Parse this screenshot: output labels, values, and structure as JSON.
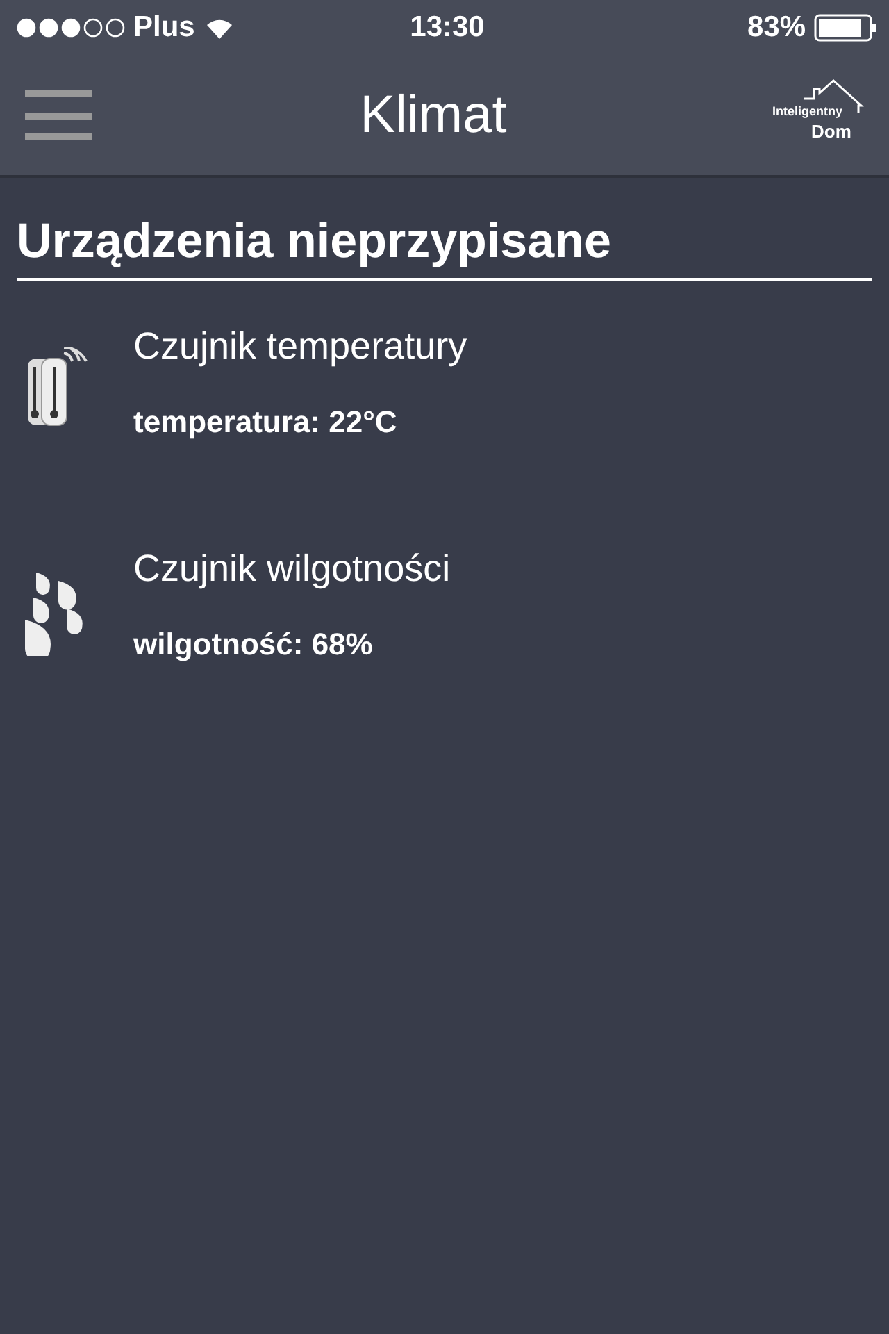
{
  "status_bar": {
    "carrier": "Plus",
    "time": "13:30",
    "battery": "83%"
  },
  "nav": {
    "title": "Klimat",
    "logo": {
      "line_1": "Inteligentny",
      "line_2": "Dom"
    }
  },
  "section": {
    "title": "Urządzenia nieprzypisane"
  },
  "devices": [
    {
      "kind": "thermometer",
      "name": "Czujnik temperatury",
      "reading": "temperatura: 22°C"
    },
    {
      "kind": "humidity",
      "name": "Czujnik wilgotności",
      "reading": "wilgotność: 68%"
    }
  ]
}
